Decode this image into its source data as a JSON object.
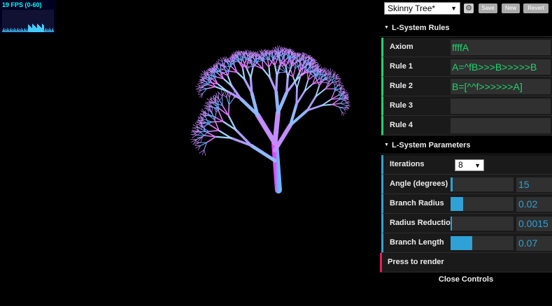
{
  "stats": {
    "fps_label": "19 FPS (0-60)",
    "fps": 19,
    "fps_min": 0,
    "fps_max": 60,
    "color": "#00ffff"
  },
  "toolbar": {
    "preset": "Skinny Tree*",
    "gear_icon": "gear-icon",
    "save_label": "Save",
    "new_label": "New",
    "revert_label": "Revert"
  },
  "rules_folder": {
    "title": "L-System Rules",
    "accent": "#1ed36f",
    "rows": [
      {
        "label": "Axiom",
        "value": "ffffA"
      },
      {
        "label": "Rule 1",
        "value": "A=^fB>>>B>>>>>B"
      },
      {
        "label": "Rule 2",
        "value": "B=[^^f>>>>>>A]"
      },
      {
        "label": "Rule 3",
        "value": ""
      },
      {
        "label": "Rule 4",
        "value": ""
      }
    ]
  },
  "params_folder": {
    "title": "L-System Parameters",
    "accent": "#2fa1d6",
    "iterations": {
      "label": "Iterations",
      "value": "8"
    },
    "sliders": [
      {
        "label": "Angle (degrees)",
        "value": "15",
        "fraction": 0.03
      },
      {
        "label": "Branch Radius",
        "value": "0.02",
        "fraction": 0.2
      },
      {
        "label": "Radius Reduction",
        "value": "0.0015",
        "fraction": 0.01
      },
      {
        "label": "Branch Length",
        "value": "0.07",
        "fraction": 0.35
      }
    ]
  },
  "render": {
    "label": "Press to render",
    "accent": "#e61d5f"
  },
  "close_controls": "Close Controls"
}
